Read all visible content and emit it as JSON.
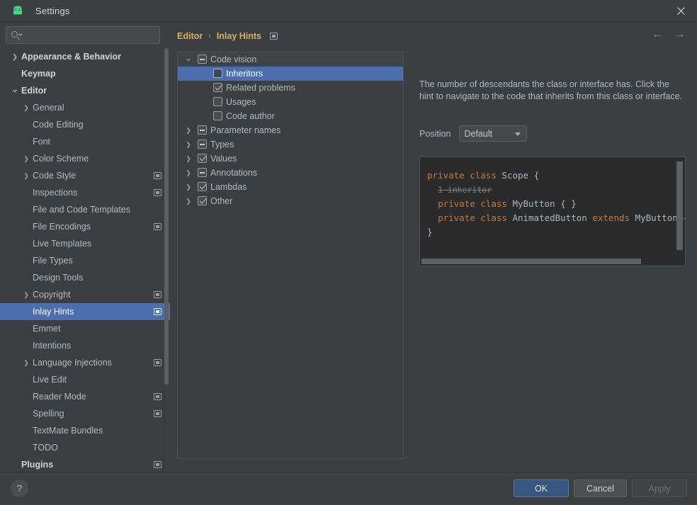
{
  "window": {
    "title": "Settings",
    "app_icon": "android-icon",
    "close_icon": "close-icon"
  },
  "search": {
    "value": "",
    "placeholder": "",
    "icon": "search-icon"
  },
  "sidebar": {
    "items": [
      {
        "label": "Appearance & Behavior",
        "indent": 0,
        "arrow": "›",
        "bold": true,
        "config_icon": false,
        "selected": false
      },
      {
        "label": "Keymap",
        "indent": 0,
        "arrow": "",
        "bold": true,
        "config_icon": false,
        "selected": false
      },
      {
        "label": "Editor",
        "indent": 0,
        "arrow": "⌄",
        "bold": true,
        "config_icon": false,
        "selected": false
      },
      {
        "label": "General",
        "indent": 1,
        "arrow": "›",
        "bold": false,
        "config_icon": false,
        "selected": false
      },
      {
        "label": "Code Editing",
        "indent": 1,
        "arrow": "",
        "bold": false,
        "config_icon": false,
        "selected": false
      },
      {
        "label": "Font",
        "indent": 1,
        "arrow": "",
        "bold": false,
        "config_icon": false,
        "selected": false
      },
      {
        "label": "Color Scheme",
        "indent": 1,
        "arrow": "›",
        "bold": false,
        "config_icon": false,
        "selected": false
      },
      {
        "label": "Code Style",
        "indent": 1,
        "arrow": "›",
        "bold": false,
        "config_icon": true,
        "selected": false
      },
      {
        "label": "Inspections",
        "indent": 1,
        "arrow": "",
        "bold": false,
        "config_icon": true,
        "selected": false
      },
      {
        "label": "File and Code Templates",
        "indent": 1,
        "arrow": "",
        "bold": false,
        "config_icon": false,
        "selected": false
      },
      {
        "label": "File Encodings",
        "indent": 1,
        "arrow": "",
        "bold": false,
        "config_icon": true,
        "selected": false
      },
      {
        "label": "Live Templates",
        "indent": 1,
        "arrow": "",
        "bold": false,
        "config_icon": false,
        "selected": false
      },
      {
        "label": "File Types",
        "indent": 1,
        "arrow": "",
        "bold": false,
        "config_icon": false,
        "selected": false
      },
      {
        "label": "Design Tools",
        "indent": 1,
        "arrow": "",
        "bold": false,
        "config_icon": false,
        "selected": false
      },
      {
        "label": "Copyright",
        "indent": 1,
        "arrow": "›",
        "bold": false,
        "config_icon": true,
        "selected": false
      },
      {
        "label": "Inlay Hints",
        "indent": 1,
        "arrow": "",
        "bold": false,
        "config_icon": true,
        "selected": true
      },
      {
        "label": "Emmet",
        "indent": 1,
        "arrow": "",
        "bold": false,
        "config_icon": false,
        "selected": false
      },
      {
        "label": "Intentions",
        "indent": 1,
        "arrow": "",
        "bold": false,
        "config_icon": false,
        "selected": false
      },
      {
        "label": "Language Injections",
        "indent": 1,
        "arrow": "›",
        "bold": false,
        "config_icon": true,
        "selected": false
      },
      {
        "label": "Live Edit",
        "indent": 1,
        "arrow": "",
        "bold": false,
        "config_icon": false,
        "selected": false
      },
      {
        "label": "Reader Mode",
        "indent": 1,
        "arrow": "",
        "bold": false,
        "config_icon": true,
        "selected": false
      },
      {
        "label": "Spelling",
        "indent": 1,
        "arrow": "",
        "bold": false,
        "config_icon": true,
        "selected": false
      },
      {
        "label": "TextMate Bundles",
        "indent": 1,
        "arrow": "",
        "bold": false,
        "config_icon": false,
        "selected": false
      },
      {
        "label": "TODO",
        "indent": 1,
        "arrow": "",
        "bold": false,
        "config_icon": false,
        "selected": false
      },
      {
        "label": "Plugins",
        "indent": 0,
        "arrow": "",
        "bold": true,
        "config_icon": true,
        "selected": false
      }
    ]
  },
  "breadcrumb": {
    "parent": "Editor",
    "separator": "›",
    "current": "Inlay Hints",
    "config_icon": "settings-config-icon"
  },
  "nav": {
    "back_icon": "←",
    "forward_icon": "→"
  },
  "tree": {
    "nodes": [
      {
        "label": "Code vision",
        "indent": 0,
        "arrow": "⌄",
        "check": "partial",
        "selected": false,
        "header": true
      },
      {
        "label": "Inheritors",
        "indent": 1,
        "arrow": "",
        "check": "unchecked",
        "selected": true,
        "header": false
      },
      {
        "label": "Related problems",
        "indent": 1,
        "arrow": "",
        "check": "checked",
        "selected": false,
        "header": false
      },
      {
        "label": "Usages",
        "indent": 1,
        "arrow": "",
        "check": "unchecked",
        "selected": false,
        "header": false
      },
      {
        "label": "Code author",
        "indent": 1,
        "arrow": "",
        "check": "unchecked",
        "selected": false,
        "header": false
      },
      {
        "label": "Parameter names",
        "indent": 0,
        "arrow": "›",
        "check": "partial",
        "selected": false,
        "header": false
      },
      {
        "label": "Types",
        "indent": 0,
        "arrow": "›",
        "check": "partial",
        "selected": false,
        "header": false
      },
      {
        "label": "Values",
        "indent": 0,
        "arrow": "›",
        "check": "checked",
        "selected": false,
        "header": false
      },
      {
        "label": "Annotations",
        "indent": 0,
        "arrow": "›",
        "check": "partial",
        "selected": false,
        "header": false
      },
      {
        "label": "Lambdas",
        "indent": 0,
        "arrow": "›",
        "check": "checked",
        "selected": false,
        "header": false
      },
      {
        "label": "Other",
        "indent": 0,
        "arrow": "›",
        "check": "checked",
        "selected": false,
        "header": false
      }
    ]
  },
  "detail": {
    "description": "The number of descendants the class or interface has. Click the hint to navigate to the code that inherits from this class or interface.",
    "position_label": "Position",
    "position_value": "Default",
    "preview": {
      "line1_kw1": "private",
      "line1_kw2": "class",
      "line1_name": "Scope",
      "line1_brace": "{",
      "hint": "1 inheritor",
      "line3": "private class MyButton { }",
      "line4": "private class AnimatedButton extends MyButton { }",
      "line5": "}"
    }
  },
  "footer": {
    "help_label": "?",
    "ok_label": "OK",
    "cancel_label": "Cancel",
    "apply_label": "Apply"
  },
  "colors": {
    "background": "#3c3f41",
    "selection": "#4b6eaf",
    "breadcrumb": "#d3b06a",
    "primary_button": "#365880",
    "code_background": "#2b2b2b",
    "keyword": "#cc7832",
    "identifier": "#a9b7c6",
    "android_green": "#3ddc84"
  }
}
